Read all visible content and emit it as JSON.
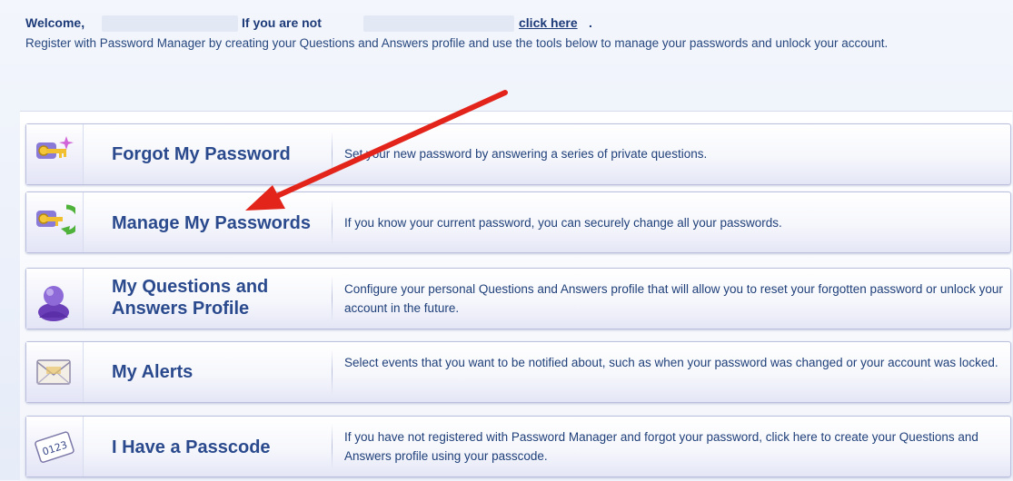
{
  "welcome": {
    "greeting": "Welcome,",
    "not_user": "If you are not",
    "link": "click here",
    "link_end": ".",
    "intro": "Register with Password Manager by creating your Questions and Answers profile and use the tools below to manage your passwords and unlock your account."
  },
  "tiles": [
    {
      "title": "Forgot My Password",
      "description": "Set your new password by answering a series of private questions.",
      "icon": "keys-sparkle-icon"
    },
    {
      "title": "Manage My Passwords",
      "description": "If you know your current password, you can securely change all your passwords.",
      "icon": "keys-refresh-icon"
    },
    {
      "title": "My Questions and Answers Profile",
      "description": "Configure your personal Questions and Answers profile that will allow you to reset your forgotten password or unlock your account in the future.",
      "icon": "user-profile-icon"
    },
    {
      "title": "My Alerts",
      "description": "Select events that you want to be notified about, such as when your password was changed or your account was locked.",
      "icon": "envelope-alert-icon"
    },
    {
      "title": "I Have a Passcode",
      "description": "If you have not registered with Password Manager and forgot your password, click here to create your Questions and Answers profile using your passcode.",
      "icon": "passcode-card-icon"
    }
  ],
  "annotation": {
    "color": "#e3241b"
  }
}
